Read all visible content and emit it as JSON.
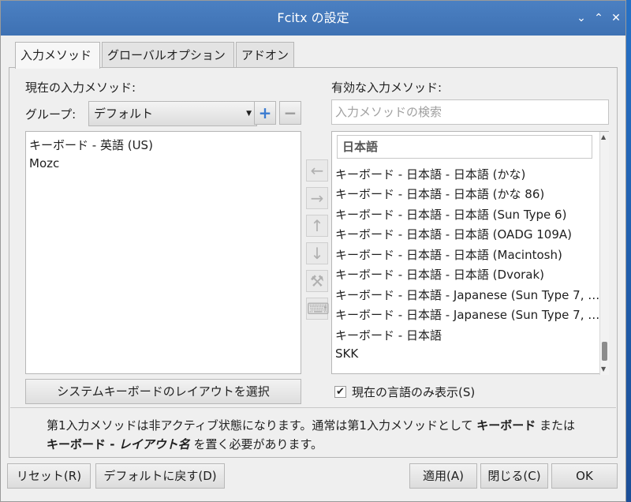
{
  "window": {
    "title": "Fcitx の設定",
    "controls": [
      "⌄",
      "⌃",
      "✕"
    ]
  },
  "tabs": [
    {
      "label": "入力メソッド"
    },
    {
      "label": "グローバルオプション"
    },
    {
      "label": "アドオン"
    }
  ],
  "left": {
    "heading": "現在の入力メソッド:",
    "group_label": "グループ:",
    "group_value": "デフォルト",
    "items": [
      "キーボード - 英語 (US)",
      "Mozc"
    ],
    "layout_button": "システムキーボードのレイアウトを選択"
  },
  "right": {
    "heading": "有効な入力メソッド:",
    "search_placeholder": "入力メソッドの検索",
    "category": "日本語",
    "items": [
      "キーボード - 日本語 - 日本語 (かな)",
      "キーボード - 日本語 - 日本語 (かな 86)",
      "キーボード - 日本語 - 日本語 (Sun Type 6)",
      "キーボード - 日本語 - 日本語 (OADG 109A)",
      "キーボード - 日本語 - 日本語 (Macintosh)",
      "キーボード - 日本語 - 日本語 (Dvorak)",
      "キーボード - 日本語 - Japanese (Sun Type 7, …",
      "キーボード - 日本語 - Japanese (Sun Type 7, …",
      "キーボード - 日本語",
      "SKK"
    ],
    "only_current_lang": "現在の言語のみ表示(S)",
    "only_current_lang_checked": true
  },
  "info": {
    "line1_a": "第1入力メソッドは非アクティブ状態になります。通常は第1入力メソッドとして ",
    "line1_b": "キーボード",
    "line1_c": " または",
    "line2_a": "キーボード - ",
    "line2_b": "レイアウト名",
    "line2_c": " を置く必要があります。"
  },
  "buttons": {
    "reset": "リセット(R)",
    "defaults": "デフォルトに戻す(D)",
    "apply": "適用(A)",
    "close": "閉じる(C)",
    "ok": "OK"
  },
  "icons": {
    "add": "+",
    "remove": "−",
    "left_arrow": "←",
    "right_arrow": "→",
    "up_arrow": "↑",
    "down_arrow": "↓",
    "configure": "⚒",
    "keyboard": "⌨"
  }
}
